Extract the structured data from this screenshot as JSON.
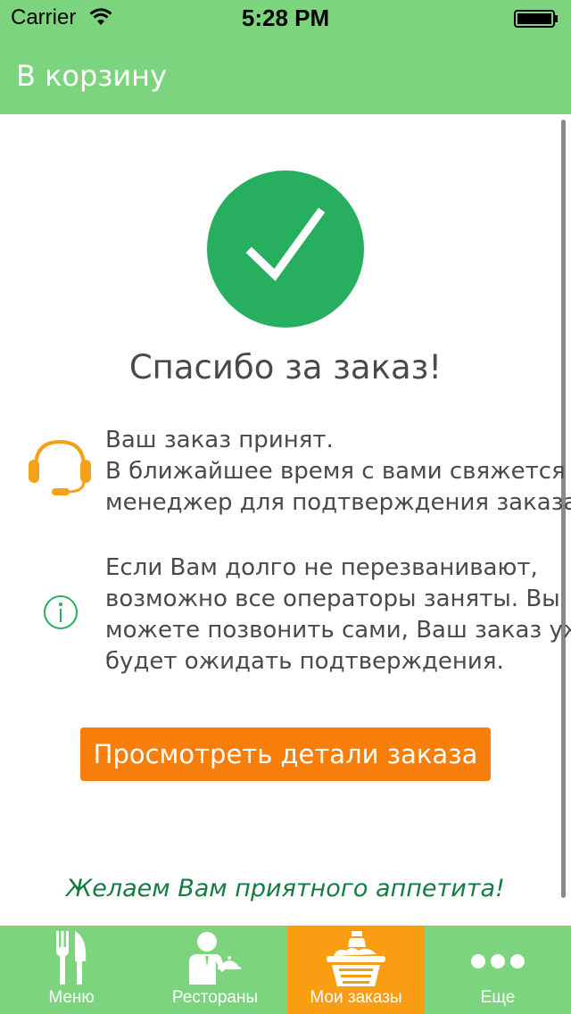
{
  "status_bar": {
    "carrier": "Carrier",
    "time": "5:28 PM",
    "icons": [
      "wifi-icon",
      "battery-icon"
    ]
  },
  "nav": {
    "back_label": "В корзину"
  },
  "main": {
    "success_icon": "checkmark-circle-icon",
    "title": "Спасибо за заказ!",
    "accepted_lines": [
      "Ваш заказ принят.",
      "В ближайшее время с вами свяжется",
      "менеджер для подтверждения заказа."
    ],
    "wait_lines": [
      "Если Вам долго не перезванивают,",
      "возможно все операторы заняты. Вы",
      "можете позвонить сами, Ваш заказ уже",
      "будет ожидать подтверждения."
    ],
    "details_button_label": "Просмотреть детали заказа",
    "footer_text": "Желаем Вам приятного аппетита!"
  },
  "tabs": [
    {
      "label": "Меню",
      "icon": "fork-knife-icon",
      "active": false
    },
    {
      "label": "Рестораны",
      "icon": "waiter-icon",
      "active": false
    },
    {
      "label": "Мои заказы",
      "icon": "basket-icon",
      "active": true
    },
    {
      "label": "Еще",
      "icon": "more-dots-icon",
      "active": false
    }
  ],
  "colors": {
    "header_green": "#7dd47f",
    "check_green": "#28ae5f",
    "button_orange": "#f87e0c",
    "active_tab_orange": "#f99d12",
    "footer_text_green": "#137d3f",
    "headset_orange": "#f3a118",
    "info_green": "#28ae5f"
  }
}
